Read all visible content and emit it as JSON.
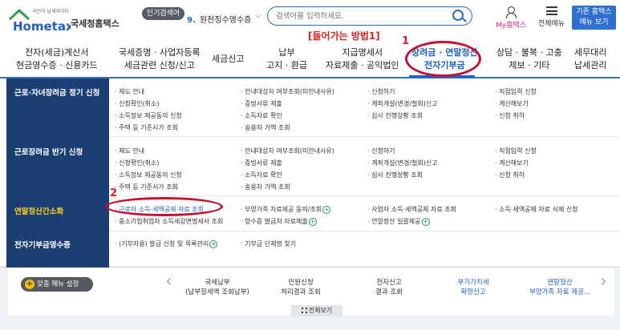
{
  "header": {
    "logo_small": "국민이 납세자이다",
    "logo_main": "Hometax",
    "logo_ko": "국세청홈택스",
    "popular_badge": "인기검색어",
    "popular_num": "9.",
    "popular_text": "원천징수영수증",
    "search_placeholder": "검색어를 입력하세요.",
    "myhome_label": "My홈택스",
    "allmenu_label": "전체메뉴",
    "basic_home_line1": "기존 홈택스",
    "basic_home_line2": "메뉴 보기"
  },
  "nav": {
    "items": [
      {
        "line1": "전자(세금)계산서",
        "line2": "현금영수증 · 신용카드"
      },
      {
        "line1": "국세증명 · 사업자등록",
        "line2": "세금관련 신청/신고"
      },
      {
        "line1": "세금신고",
        "line2": ""
      },
      {
        "line1": "납부",
        "line2": "고지 · 환급"
      },
      {
        "line1": "지급명세서",
        "line2": "자료제출 · 공익법인"
      },
      {
        "line1": "장려금 · 연말정산",
        "line2": "전자기부금"
      },
      {
        "line1": "상담 · 불복 · 고충",
        "line2": "제보 · 기타"
      },
      {
        "line1": "세무대리",
        "line2": "납세관리"
      }
    ]
  },
  "annotations": {
    "how_to_enter": "[들어가는 방법1]",
    "step1": "1",
    "step2": "2"
  },
  "mega": {
    "rows": [
      {
        "title": "근로·자녀장려금 정기 신청",
        "links": [
          "· 제도 안내",
          "· 신청확인(취소)",
          "· 소득정보 제공동의 신청",
          "· 주택 등 기준시가 조회",
          "· 안내대상자 여부조회(미안내사유)",
          "· 증빙서류 제출",
          "· 소득자료 확인",
          "· 송용차 가액 조회",
          "· 신청하기",
          "· 계좌개설(변경/철회)신고",
          "· 심사 진행상황 조회",
          "· 직접입력 신청",
          "· 계산해보기",
          "· 신청 취하"
        ]
      },
      {
        "title": "근로장려금 반기 신청",
        "links": [
          "· 제도 안내",
          "· 신청확인(취소)",
          "· 소득정보 제공동의 신청",
          "· 주택 등 기준시가 조회",
          "· 안내대상자 여부조회(미안내사유)",
          "· 증빙서류 제출",
          "· 소득자료 확인",
          "· 송용차 가액 조회",
          "· 신청하기",
          "· 계좌개설(변경/철회)신고",
          "· 심사 진행상황 조회",
          "· 직접입력 신청",
          "· 계산해보기",
          "· 신청 취하"
        ]
      },
      {
        "title": "연말정산간소화",
        "links": [
          "· 근로자 소득·세액공제 자료 조회",
          "· 중소기업취업자 소득세감면명세서 조회",
          "· 부양가족 자료제공 동의/조회",
          "· 영수증 발급처 자료제출",
          "· 사업자 소득·세액공제 자료 조회",
          "· 연말정산 일괄제공",
          "· 소득·세액공제 자료 삭제 신청"
        ]
      },
      {
        "title": "전자기부금영수증",
        "links": [
          "· (기부자용) 발급 신청 및 목록관리",
          "· 기부금 단체명 찾기"
        ]
      }
    ]
  },
  "quick": {
    "custom_menu": "맞춤 메뉴 설정",
    "items": [
      {
        "line1": "국세납부",
        "line2": "(납부할세액 조회납부)"
      },
      {
        "line1": "민원신청",
        "line2": "처리결과 조회"
      },
      {
        "line1": "전자신고",
        "line2": "결과 조회"
      },
      {
        "line1": "부가가치세",
        "line2": "확정신고"
      },
      {
        "line1": "연말정산",
        "line2": "부양가족 자료 제공..."
      }
    ],
    "full_view": "전체보기"
  },
  "colors": {
    "brand_blue": "#2f6fd1",
    "sidebar_navy": "#1c3f73",
    "annotation_red": "#e02020",
    "highlight_yellow": "#ffd21a"
  }
}
